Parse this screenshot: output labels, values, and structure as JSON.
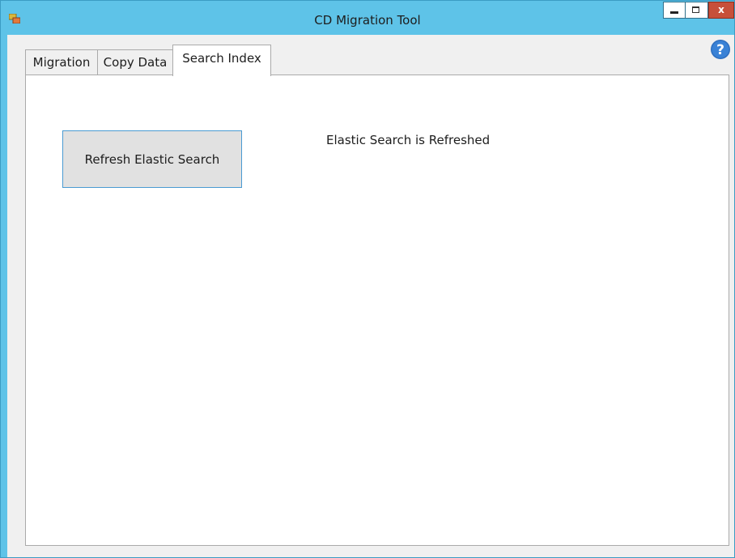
{
  "window": {
    "title": "CD Migration Tool",
    "close_label": "x",
    "app_icon": "app-icon",
    "colors": {
      "title_bar": "#5ec3e8",
      "close_button": "#c7503a",
      "client_background": "#f0f0f0",
      "button_border": "#4a9bd2",
      "help_icon": "#2f6fbf"
    }
  },
  "tabs": [
    {
      "label": "Migration",
      "active": false
    },
    {
      "label": "Copy Data",
      "active": false
    },
    {
      "label": "Search Index",
      "active": true
    }
  ],
  "search_index": {
    "refresh_button_label": "Refresh Elastic Search",
    "status_text": "Elastic Search is Refreshed"
  },
  "help": {
    "icon": "help-icon",
    "glyph": "?"
  }
}
